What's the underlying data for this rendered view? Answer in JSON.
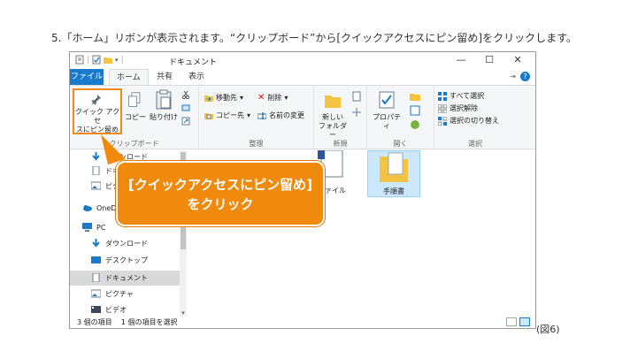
{
  "instruction": "5.「ホーム」リボンが表示されます。“クリップボード”から[クイックアクセスにピン留め]をクリックします。",
  "window": {
    "title": "ドキュメント",
    "controls": {
      "minimize": "—",
      "maximize": "☐",
      "close": "✕"
    }
  },
  "tabs": {
    "file": "ファイル",
    "home": "ホーム",
    "share": "共有",
    "view": "表示"
  },
  "ribbon": {
    "clipboard": {
      "pin_label_1": "クイック アクセ",
      "pin_label_2": "スにピン留め",
      "copy": "コピー",
      "paste": "貼り付け",
      "group": "クリップボード"
    },
    "organize": {
      "move_to": "移動先",
      "delete": "削除",
      "copy_to": "コピー先",
      "rename": "名前の変更",
      "group": "整理"
    },
    "new": {
      "new_folder_1": "新しい",
      "new_folder_2": "フォルダー",
      "group": "新規"
    },
    "open": {
      "properties": "プロパティ",
      "group": "開く"
    },
    "select": {
      "select_all": "すべて選択",
      "select_none": "選択解除",
      "invert": "選択の切り替え",
      "group": "選択"
    }
  },
  "nav": {
    "items": [
      {
        "label": "ダウンロード"
      },
      {
        "label": "ドキュメント"
      },
      {
        "label": "ピクチャ"
      },
      {
        "label": "OneDrive"
      },
      {
        "label": "PC"
      },
      {
        "label": "ダウンロード"
      },
      {
        "label": "デスクトップ"
      },
      {
        "label": "ドキュメント"
      },
      {
        "label": "ピクチャ"
      },
      {
        "label": "ビデオ"
      }
    ]
  },
  "content": {
    "files": [
      {
        "label": "ファイル"
      },
      {
        "label": "手順書"
      }
    ]
  },
  "status": {
    "count": "3 個の項目",
    "selected": "1 個の項目を選択"
  },
  "callout": {
    "line1": "[クイックアクセスにピン留め]",
    "line2": "をクリック"
  },
  "figure_label": "(図6)",
  "colors": {
    "accent": "#1979ca",
    "callout": "#f08a0c",
    "folder": "#f5c342"
  }
}
